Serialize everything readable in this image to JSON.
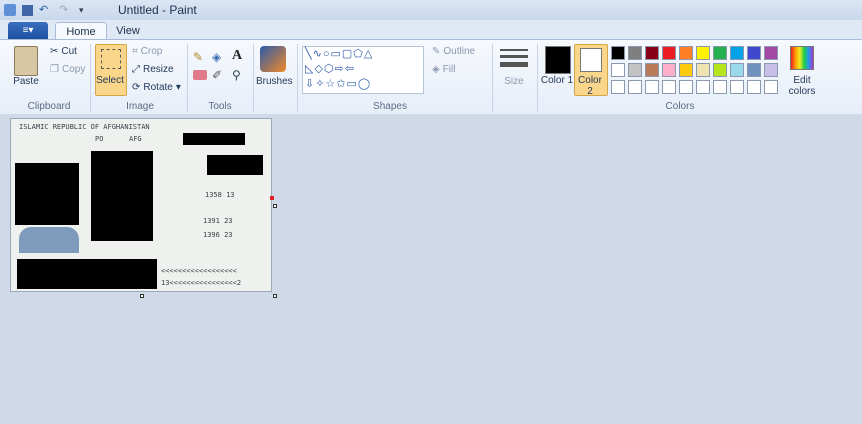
{
  "window": {
    "title": "Untitled - Paint"
  },
  "tabs": [
    {
      "label": "Home",
      "active": true
    },
    {
      "label": "View",
      "active": false
    }
  ],
  "file_button": {
    "label": "≡▾"
  },
  "clipboard": {
    "paste": "Paste",
    "cut": "Cut",
    "copy": "Copy",
    "group": "Clipboard"
  },
  "image": {
    "select": "Select",
    "crop": "Crop",
    "resize": "Resize",
    "rotate": "Rotate",
    "group": "Image"
  },
  "tools": {
    "group": "Tools"
  },
  "brushes": {
    "label": "Brushes"
  },
  "shapes": {
    "outline": "Outline",
    "fill": "Fill",
    "group": "Shapes"
  },
  "size": {
    "label": "Size"
  },
  "colors": {
    "color1_label": "Color 1",
    "color2_label": "Color 2",
    "edit": "Edit colors",
    "group": "Colors",
    "color1": "#000000",
    "color2": "#ffffff",
    "palette_row1": [
      "#000000",
      "#7f7f7f",
      "#880015",
      "#ed1c24",
      "#ff7f27",
      "#fff200",
      "#22b14c",
      "#00a2e8",
      "#3f48cc",
      "#a349a4"
    ],
    "palette_row2": [
      "#ffffff",
      "#c3c3c3",
      "#b97a57",
      "#ffaec9",
      "#ffc90e",
      "#efe4b0",
      "#b5e61d",
      "#99d9ea",
      "#7092be",
      "#c8bfe7"
    ],
    "palette_row3": [
      "#ffffff",
      "#ffffff",
      "#ffffff",
      "#ffffff",
      "#ffffff",
      "#ffffff",
      "#ffffff",
      "#ffffff",
      "#ffffff",
      "#ffffff"
    ]
  },
  "document": {
    "header_line": "ISLAMIC REPUBLIC OF AFGHANISTAN",
    "code_po": "PO",
    "code_afg": "AFG",
    "date1": "1358  13",
    "date2": "1391  23",
    "date3": "1396  23",
    "mrz_line1": "<<<<<<<<<<<<<<<<<<",
    "mrz_line2": "13<<<<<<<<<<<<<<<<2"
  }
}
